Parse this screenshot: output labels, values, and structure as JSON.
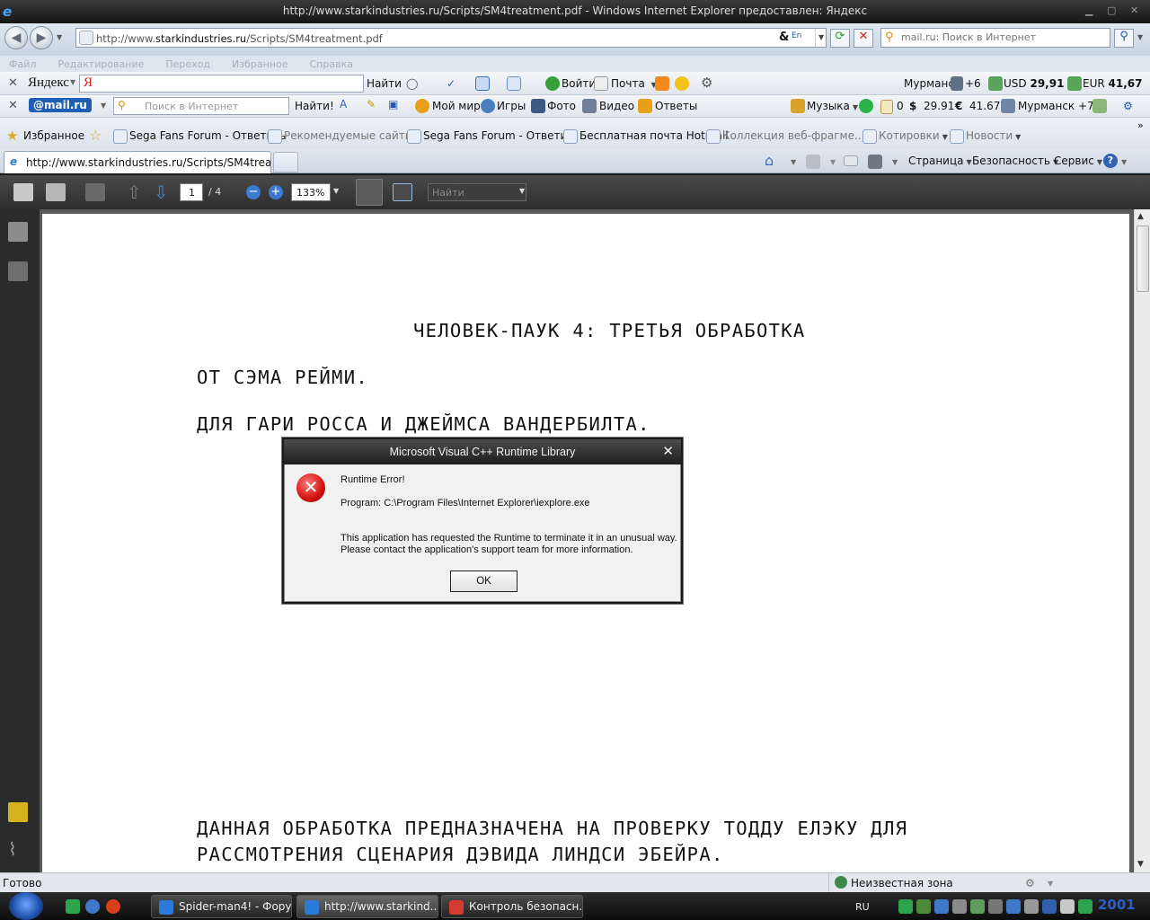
{
  "window": {
    "title": "http://www.starkindustries.ru/Scripts/SM4treatment.pdf - Windows Internet Explorer предоставлен: Яндекс"
  },
  "address": {
    "url_prefix": "http://www.",
    "url_domain": "starkindustries.ru",
    "url_path": "/Scripts/SM4treatment.pdf"
  },
  "search": {
    "placeholder": "mail.ru: Поиск в Интернет"
  },
  "menu": [
    "Файл",
    "Редактирование",
    "Переход",
    "Избранное",
    "Справка"
  ],
  "yandex_bar": {
    "logo": "Яндекс",
    "find_label": "Найти",
    "city": "Мурманск",
    "temp": "+6",
    "usd": "USD 29,91",
    "eur": "EUR 41,67"
  },
  "mail_bar": {
    "logo": "@mail.ru",
    "search_placeholder": "Поиск в Интернет",
    "find_label": "Найти!",
    "items": [
      "Мой мир",
      "Игры",
      "Фото",
      "Видео",
      "Ответы"
    ],
    "music": "Музыка",
    "mail_count": "0",
    "usd": "29.91",
    "eur": "41.67",
    "weather": "Мурманск +7°C"
  },
  "favorites": {
    "label": "Избранное",
    "links": [
      "Sega Fans Forum - Ответить",
      "Рекомендуемые сайты",
      "Sega Fans Forum - Ответи...",
      "Бесплатная почта Hotmail",
      "Коллекция веб-фрагме...",
      "Котировки",
      "Новости"
    ]
  },
  "tabs": {
    "active": "http://www.starkindustries.ru/Scripts/SM4treatment....",
    "cmd": [
      "Страница",
      "Безопасность",
      "Сервис"
    ]
  },
  "pdf_toolbar": {
    "page": "1",
    "total": "/ 4",
    "zoom": "133%",
    "find_placeholder": "Найти"
  },
  "pdf_page": {
    "title": "ЧЕЛОВЕК-ПАУК 4: ТРЕТЬЯ ОБРАБОТКА",
    "line1": "ОТ СЭМА РЕЙМИ.",
    "line2": "ДЛЯ ГАРИ РОССА И ДЖЕЙМСА ВАНДЕРБИЛТА.",
    "line3": "ДАННАЯ ОБРАБОТКА ПРЕДНАЗНАЧЕНА НА ПРОВЕРКУ ТОДДУ ЕЛЭКУ ДЛЯ",
    "line4": "РАССМОТРЕНИЯ СЦЕНАРИЯ ДЭВИДА ЛИНДСИ ЭБЕЙРА."
  },
  "dialog": {
    "title": "Microsoft Visual C++ Runtime Library",
    "heading": "Runtime Error!",
    "program": "Program: C:\\Program Files\\Internet Explorer\\iexplore.exe",
    "msg1": "This application has requested the Runtime to terminate it in an unusual way.",
    "msg2": "Please contact the application's support team for more information.",
    "ok": "OK"
  },
  "status": {
    "text": "Готово",
    "zone": "Неизвестная зона"
  },
  "taskbar": {
    "tasks": [
      "Spider-man4! - Фору...",
      "http://www.starkind...",
      "Контроль безопасн..."
    ],
    "lang": "RU",
    "clock": "2001"
  },
  "colors": {
    "taskbar": "#0c0c0c",
    "pdf_toolbar": "#2d2d2d",
    "error_red": "#d41010",
    "mailru_blue": "#1f5fb3"
  }
}
